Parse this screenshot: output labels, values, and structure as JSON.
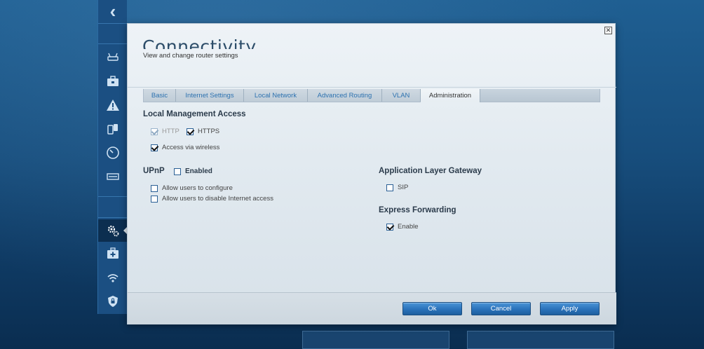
{
  "modal": {
    "title": "Connectivity",
    "subtitle": "View and change router settings",
    "close_icon": "close-icon"
  },
  "tabs": [
    {
      "label": "Basic",
      "active": false
    },
    {
      "label": "Internet Settings",
      "active": false
    },
    {
      "label": "Local Network",
      "active": false
    },
    {
      "label": "Advanced Routing",
      "active": false
    },
    {
      "label": "VLAN",
      "active": false
    },
    {
      "label": "Administration",
      "active": true
    }
  ],
  "local_management": {
    "title": "Local Management Access",
    "http_label": "HTTP",
    "http_checked": true,
    "https_label": "HTTPS",
    "https_checked": true,
    "wireless_label": "Access via wireless",
    "wireless_checked": true
  },
  "upnp": {
    "title": "UPnP",
    "enabled_label": "Enabled",
    "enabled_checked": false,
    "allow_configure_label": "Allow users to configure",
    "allow_disable_label": "Allow users to disable Internet access"
  },
  "alg": {
    "title": "Application Layer Gateway",
    "sip_label": "SIP",
    "sip_checked": false
  },
  "express_forwarding": {
    "title": "Express Forwarding",
    "enable_label": "Enable",
    "enable_checked": true
  },
  "footer": {
    "ok_label": "Ok",
    "cancel_label": "Cancel",
    "apply_label": "Apply"
  },
  "rail": {
    "icons": [
      "router-icon",
      "toolbox-icon",
      "warning-icon",
      "devices-icon",
      "speed-icon",
      "usb-icon",
      "settings-icon",
      "first-aid-icon",
      "wifi-icon",
      "security-icon"
    ],
    "active": "settings-icon"
  },
  "colors": {
    "accent": "#2a72ba",
    "tab_text": "#2d72b0",
    "background": "#174d7c"
  }
}
